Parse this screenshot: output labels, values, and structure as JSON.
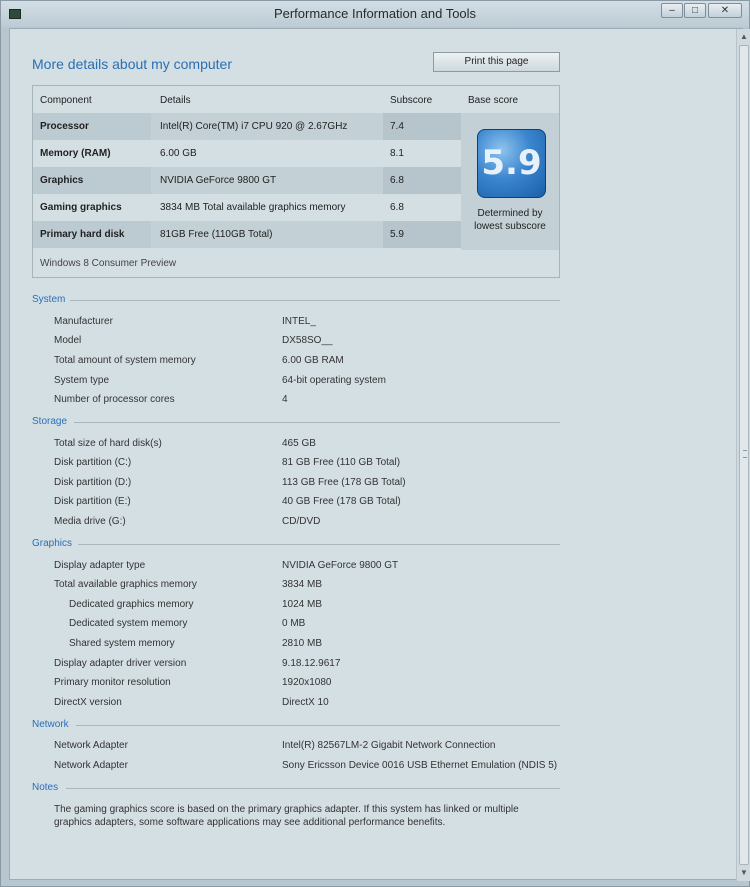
{
  "window": {
    "title": "Performance Information and Tools",
    "buttons": {
      "minimize": "–",
      "maximize": "□",
      "close": "✕"
    }
  },
  "page": {
    "heading": "More details about my computer",
    "print_button": "Print this page"
  },
  "scores": {
    "headers": {
      "component": "Component",
      "details": "Details",
      "subscore": "Subscore",
      "base": "Base score"
    },
    "rows": [
      {
        "component": "Processor",
        "details": "Intel(R) Core(TM) i7 CPU 920 @ 2.67GHz",
        "subscore": "7.4"
      },
      {
        "component": "Memory (RAM)",
        "details": "6.00 GB",
        "subscore": "8.1"
      },
      {
        "component": "Graphics",
        "details": "NVIDIA GeForce 9800 GT",
        "subscore": "6.8"
      },
      {
        "component": "Gaming graphics",
        "details": "3834 MB Total available graphics memory",
        "subscore": "6.8"
      },
      {
        "component": "Primary hard disk",
        "details": "81GB Free (110GB Total)",
        "subscore": "5.9"
      }
    ],
    "base_score": "5.9",
    "base_caption_1": "Determined by",
    "base_caption_2": "lowest subscore",
    "edition": "Windows 8 Consumer Preview"
  },
  "sections": {
    "system": {
      "title": "System",
      "rows": [
        {
          "label": "Manufacturer",
          "value": "INTEL_"
        },
        {
          "label": "Model",
          "value": "DX58SO__"
        },
        {
          "label": "Total amount of system memory",
          "value": "6.00 GB RAM"
        },
        {
          "label": "System type",
          "value": "64-bit operating system"
        },
        {
          "label": "Number of processor cores",
          "value": "4"
        }
      ]
    },
    "storage": {
      "title": "Storage",
      "rows": [
        {
          "label": "Total size of hard disk(s)",
          "value": "465 GB"
        },
        {
          "label": "Disk partition (C:)",
          "value": "81 GB Free (110 GB Total)"
        },
        {
          "label": "Disk partition (D:)",
          "value": "113 GB Free (178 GB Total)"
        },
        {
          "label": "Disk partition (E:)",
          "value": "40 GB Free (178 GB Total)"
        },
        {
          "label": "Media drive (G:)",
          "value": "CD/DVD"
        }
      ]
    },
    "graphics": {
      "title": "Graphics",
      "rows": [
        {
          "label": "Display adapter type",
          "value": "NVIDIA GeForce 9800 GT"
        },
        {
          "label": "Total available graphics memory",
          "value": "3834 MB"
        },
        {
          "label": "Dedicated graphics memory",
          "value": "1024 MB"
        },
        {
          "label": "Dedicated system memory",
          "value": "0 MB"
        },
        {
          "label": "Shared system memory",
          "value": "2810 MB"
        },
        {
          "label": "Display adapter driver version",
          "value": "9.18.12.9617"
        },
        {
          "label": "Primary monitor resolution",
          "value": "1920x1080"
        },
        {
          "label": "DirectX version",
          "value": "DirectX 10"
        }
      ]
    },
    "network": {
      "title": "Network",
      "rows": [
        {
          "label": "Network Adapter",
          "value": "Intel(R) 82567LM-2 Gigabit Network Connection"
        },
        {
          "label": "Network Adapter",
          "value": "Sony Ericsson Device 0016 USB Ethernet Emulation (NDIS 5)"
        }
      ]
    },
    "notes": {
      "title": "Notes",
      "text": "The gaming graphics score is based on the primary graphics adapter. If this system has linked or multiple graphics adapters, some software applications may see additional performance benefits."
    }
  },
  "icons": {
    "app": "performance-app-icon",
    "scroll_up": "▲",
    "scroll_down": "▼"
  }
}
